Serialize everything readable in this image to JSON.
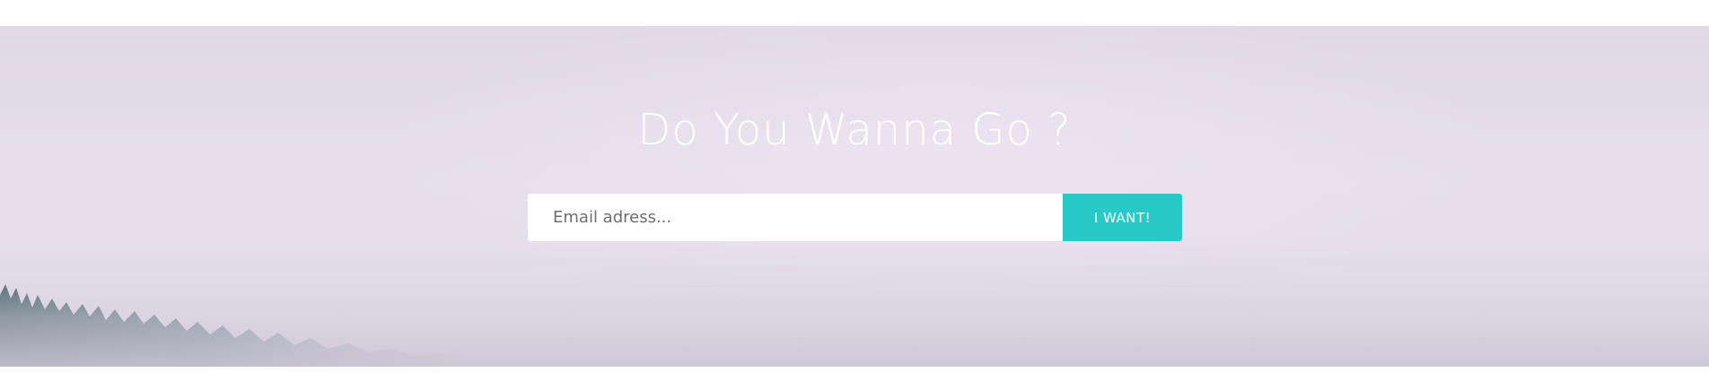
{
  "hero": {
    "title": "Do You Wanna Go ?",
    "email_placeholder": "Email adress...",
    "email_value": "",
    "submit_label": "I WANT!"
  },
  "colors": {
    "accent": "#27c9c9",
    "hero_background": "#e3dce8",
    "title_text": "#ffffff"
  }
}
